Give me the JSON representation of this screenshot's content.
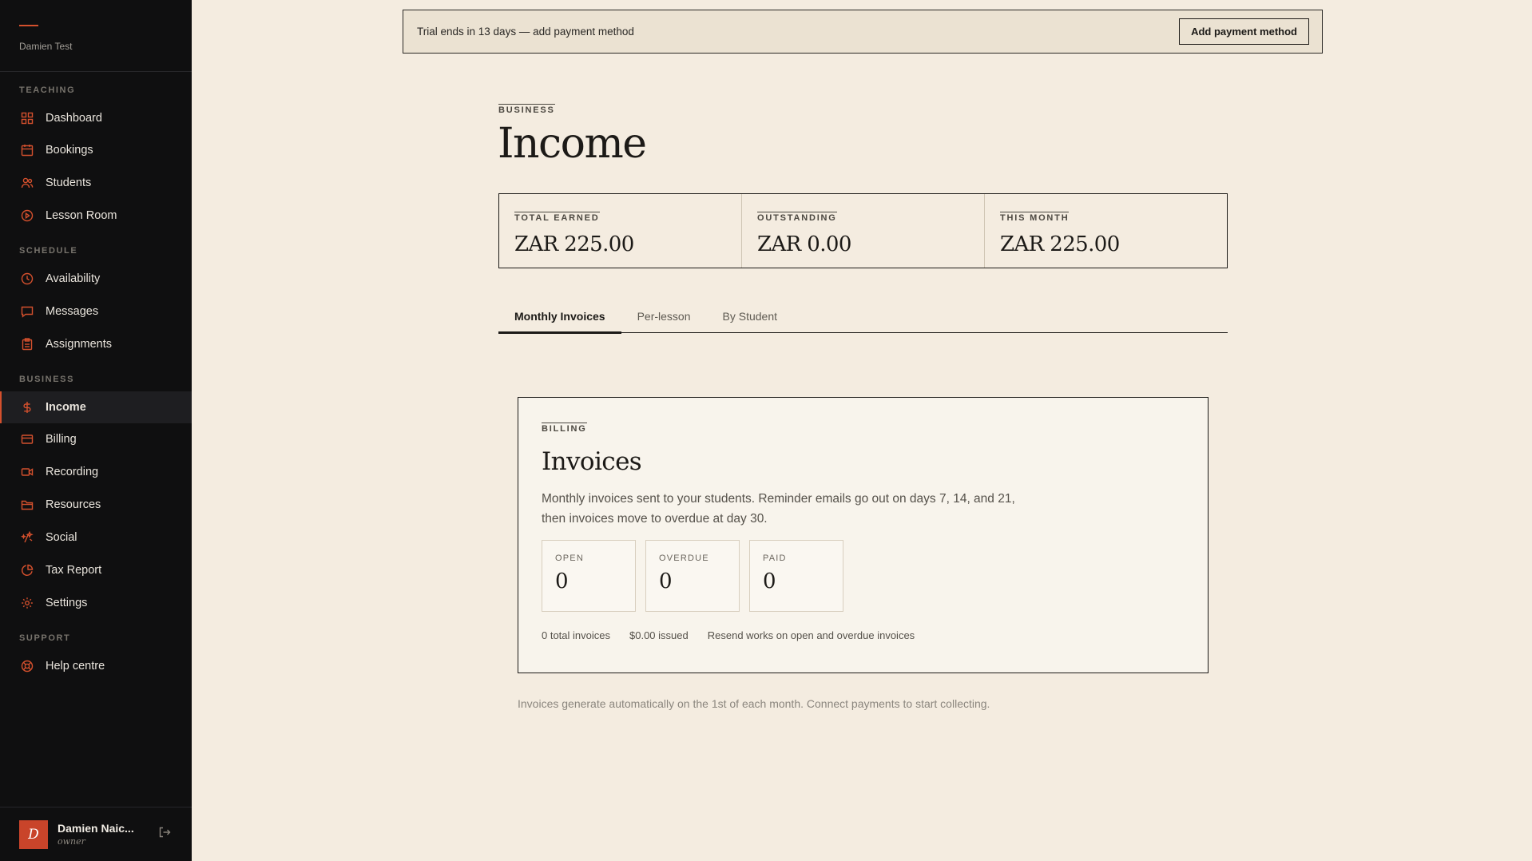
{
  "sidebar": {
    "brand_name": "Damien Test",
    "sections": {
      "teaching": "TEACHING",
      "schedule": "SCHEDULE",
      "business": "BUSINESS",
      "support": "SUPPORT"
    },
    "items": {
      "dashboard": "Dashboard",
      "bookings": "Bookings",
      "students": "Students",
      "lesson_room": "Lesson Room",
      "availability": "Availability",
      "messages": "Messages",
      "assignments": "Assignments",
      "income": "Income",
      "billing": "Billing",
      "recording": "Recording",
      "resources": "Resources",
      "social": "Social",
      "tax_report": "Tax Report",
      "settings": "Settings",
      "help_centre": "Help centre"
    },
    "active_item": "Income",
    "user": {
      "initial": "D",
      "name": "Damien Naic...",
      "role": "owner"
    }
  },
  "banner": {
    "text": "Trial ends in 13 days — add payment method",
    "button_label": "Add payment method"
  },
  "header": {
    "eyebrow": "BUSINESS",
    "title": "Income"
  },
  "stats": [
    {
      "label": "TOTAL EARNED",
      "value": "ZAR 225.00"
    },
    {
      "label": "OUTSTANDING",
      "value": "ZAR 0.00"
    },
    {
      "label": "THIS MONTH",
      "value": "ZAR 225.00"
    }
  ],
  "tabs": [
    {
      "label": "Monthly Invoices",
      "active": true
    },
    {
      "label": "Per-lesson",
      "active": false
    },
    {
      "label": "By Student",
      "active": false
    }
  ],
  "invoices_card": {
    "eyebrow": "BILLING",
    "title": "Invoices",
    "description": "Monthly invoices sent to your students. Reminder emails go out on days 7, 14, and 21, then invoices move to overdue at day 30.",
    "counts": [
      {
        "label": "OPEN",
        "value": "0"
      },
      {
        "label": "OVERDUE",
        "value": "0"
      },
      {
        "label": "PAID",
        "value": "0"
      }
    ],
    "meta": {
      "total": "0 total invoices",
      "issued": "$0.00 issued",
      "resend_note": "Resend works on open and overdue invoices"
    }
  },
  "footnote": "Invoices generate automatically on the 1st of each month. Connect payments to start collecting.",
  "colors": {
    "accent": "#d4502d",
    "sidebar_bg": "#0f0f10",
    "page_bg": "#f4ece0",
    "banner_bg": "#ebe2d2"
  }
}
